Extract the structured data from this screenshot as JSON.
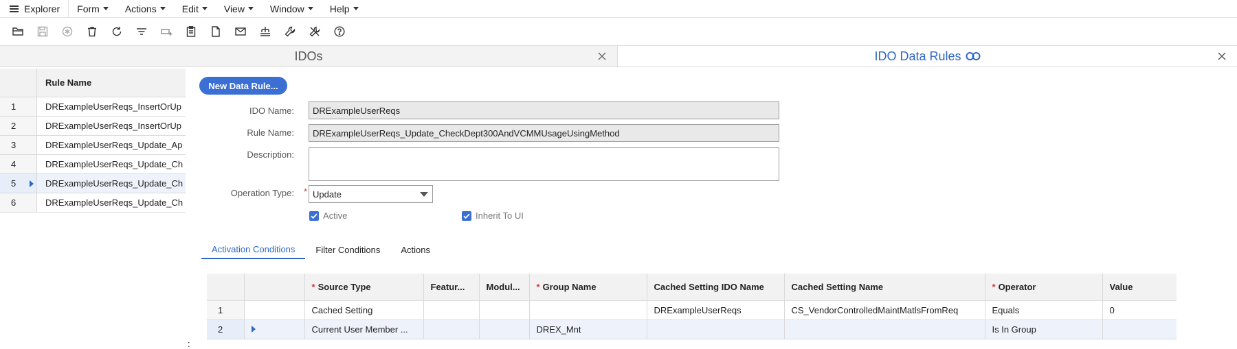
{
  "menu": {
    "explorer": "Explorer",
    "items": [
      "Form",
      "Actions",
      "Edit",
      "View",
      "Window",
      "Help"
    ]
  },
  "toolbar": {
    "icons": [
      "open-folder-icon",
      "save-icon",
      "asterisk-icon",
      "delete-icon",
      "refresh-icon",
      "filter-icon",
      "add-row-icon",
      "clipboard-icon",
      "document-icon",
      "mail-icon",
      "hierarchy-icon",
      "wrench-icon",
      "tools-icon",
      "help-icon"
    ]
  },
  "tabs": {
    "left": "IDOs",
    "right": "IDO Data Rules"
  },
  "left_grid": {
    "header": "Rule Name",
    "rows": [
      {
        "num": "1",
        "name": "DRExampleUserReqs_InsertOrUp"
      },
      {
        "num": "2",
        "name": "DRExampleUserReqs_InsertOrUp"
      },
      {
        "num": "3",
        "name": "DRExampleUserReqs_Update_Ap"
      },
      {
        "num": "4",
        "name": "DRExampleUserReqs_Update_Ch"
      },
      {
        "num": "5",
        "name": "DRExampleUserReqs_Update_Ch"
      },
      {
        "num": "6",
        "name": "DRExampleUserReqs_Update_Ch"
      }
    ]
  },
  "form": {
    "new_button": "New Data Rule...",
    "ido_name_label": "IDO Name:",
    "ido_name_value": "DRExampleUserReqs",
    "rule_name_label": "Rule Name:",
    "rule_name_value": "DRExampleUserReqs_Update_CheckDept300AndVCMMUsageUsingMethod",
    "description_label": "Description:",
    "description_value": "",
    "operation_type_label": "Operation Type:",
    "required_mark": "*",
    "operation_type_value": "Update",
    "active_label": "Active",
    "inherit_label": "Inherit To UI"
  },
  "subtabs": [
    "Activation Conditions",
    "Filter Conditions",
    "Actions"
  ],
  "conditions_grid": {
    "required_mark": "*",
    "headers": [
      "",
      "",
      "Source Type",
      "Featur...",
      "Modul...",
      "Group Name",
      "Cached Setting IDO Name",
      "Cached Setting Name",
      "Operator",
      "Value"
    ],
    "rows": [
      [
        "1",
        "",
        "Cached Setting",
        "",
        "",
        "",
        "DRExampleUserReqs",
        "CS_VendorControlledMaintMatlsFromReq",
        "Equals",
        "0"
      ],
      [
        "2",
        "",
        "Current User Member ...",
        "",
        "",
        "DREX_Mnt",
        "",
        "",
        "Is In Group",
        ""
      ]
    ]
  },
  "footer": {
    "colon": ":"
  }
}
